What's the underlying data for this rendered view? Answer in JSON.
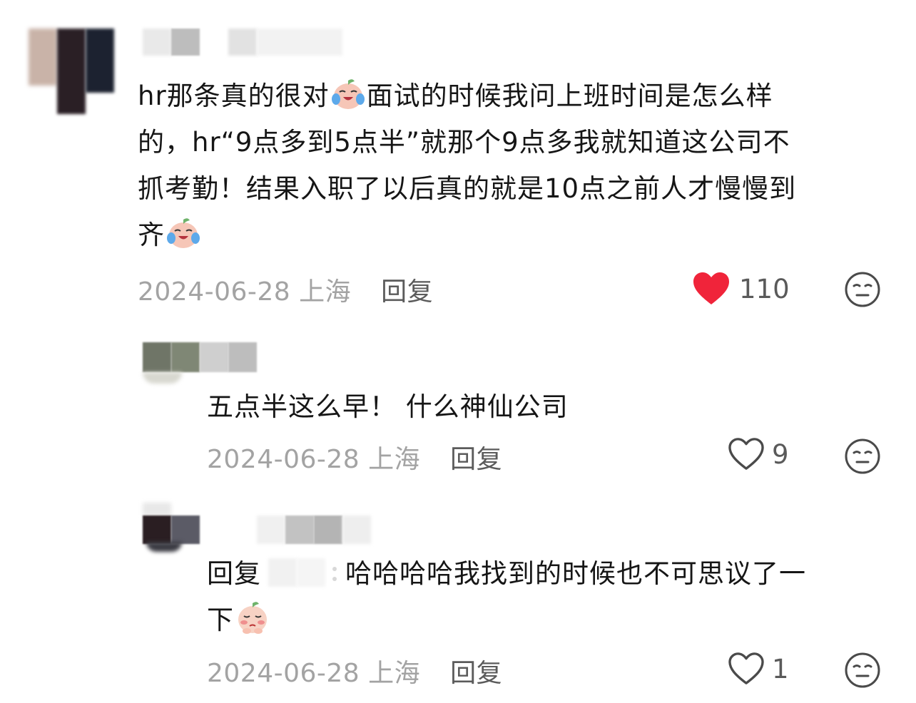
{
  "comments": [
    {
      "text_parts": [
        "hr那条真的很对",
        "面试的时候我问上班时间是怎么样的，hr“9点多到5点半”就那个9点多我就知道这公司不抓考勤！结果入职了以后真的就是10点之前人才慢慢到齐"
      ],
      "line1a": "hr那条真的很对",
      "line1b": "面试的时候我问上班时间是怎么样",
      "line2": "的，hr“9点多到5点半”就那个9点多我就知道这公司不",
      "line3": "抓考勤！结果入职了以后真的就是10点之前人才慢慢到",
      "line4": "齐",
      "date": "2024-06-28",
      "location": "上海",
      "reply_label": "回复",
      "likes": "110",
      "liked": true,
      "emoji": "crying-laughing-peach-emoji"
    },
    {
      "text": "五点半这么早！ 什么神仙公司",
      "date": "2024-06-28",
      "location": "上海",
      "reply_label": "回复",
      "likes": "9",
      "liked": false
    },
    {
      "reply_prefix": "回复",
      "line1": "哈哈哈哈我找到的时候也不可思议了一",
      "line2": "下",
      "date": "2024-06-28",
      "location": "上海",
      "reply_label": "回复",
      "likes": "1",
      "liked": false,
      "emoji": "shy-peach-emoji"
    }
  ],
  "colors": {
    "heart_filled": "#f0243a",
    "heart_outline": "#4a4a4a",
    "meta_gray": "#a3a3a3",
    "text": "#161616"
  },
  "icons": [
    "heart-icon",
    "neutral-face-icon"
  ]
}
